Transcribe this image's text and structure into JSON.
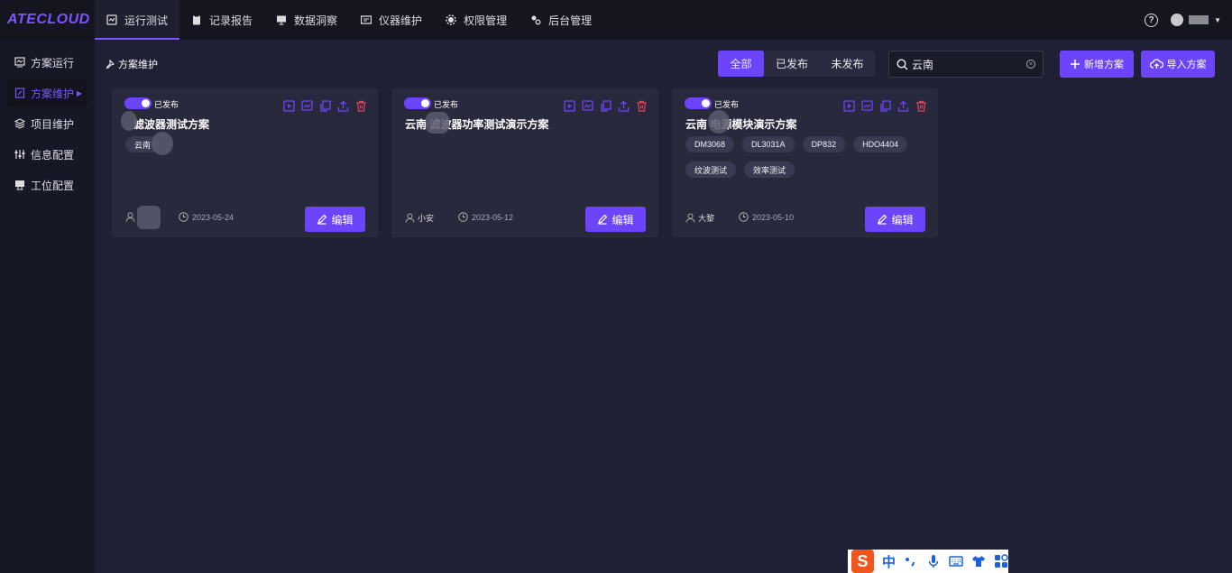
{
  "logo": "ATECLOUD",
  "nav": [
    {
      "label": "运行测试",
      "icon": "run-test-icon",
      "active": true
    },
    {
      "label": "记录报告",
      "icon": "report-icon"
    },
    {
      "label": "数据洞察",
      "icon": "data-insight-icon"
    },
    {
      "label": "仪器维护",
      "icon": "instrument-icon"
    },
    {
      "label": "权限管理",
      "icon": "permission-icon"
    },
    {
      "label": "后台管理",
      "icon": "admin-icon"
    }
  ],
  "sidebar": [
    {
      "label": "方案运行",
      "icon": "plan-run-icon"
    },
    {
      "label": "方案维护",
      "icon": "plan-maintain-icon",
      "active": true
    },
    {
      "label": "项目维护",
      "icon": "project-icon"
    },
    {
      "label": "信息配置",
      "icon": "info-config-icon"
    },
    {
      "label": "工位配置",
      "icon": "station-config-icon"
    }
  ],
  "header": {
    "title": "方案维护"
  },
  "filter": {
    "all": "全部",
    "published": "已发布",
    "unpublished": "未发布",
    "selected": "全部"
  },
  "search": {
    "value": "云南"
  },
  "buttons": {
    "new": "新增方案",
    "import": "导入方案"
  },
  "cards": [
    {
      "status": "已发布",
      "title": "滤波器测试方案",
      "tags": [
        "云南"
      ],
      "owner": "",
      "date": "2023-05-24",
      "edit": "编辑"
    },
    {
      "status": "已发布",
      "title": "云南 滤波器功率测试演示方案",
      "tags": [],
      "owner": "小安",
      "date": "2023-05-12",
      "edit": "编辑"
    },
    {
      "status": "已发布",
      "title": "云南 电源模块演示方案",
      "tags": [
        "DM3068",
        "DL3031A",
        "DP832",
        "HDO4404",
        "纹波测试",
        "效率测试"
      ],
      "owner": "大黎",
      "date": "2023-05-10",
      "edit": "编辑"
    }
  ],
  "ime": {
    "logo": "S",
    "lang": "中"
  },
  "colors": {
    "accent": "#6c44fb",
    "bg": "#1f2033",
    "card": "#29293e",
    "danger": "#e0445a"
  }
}
